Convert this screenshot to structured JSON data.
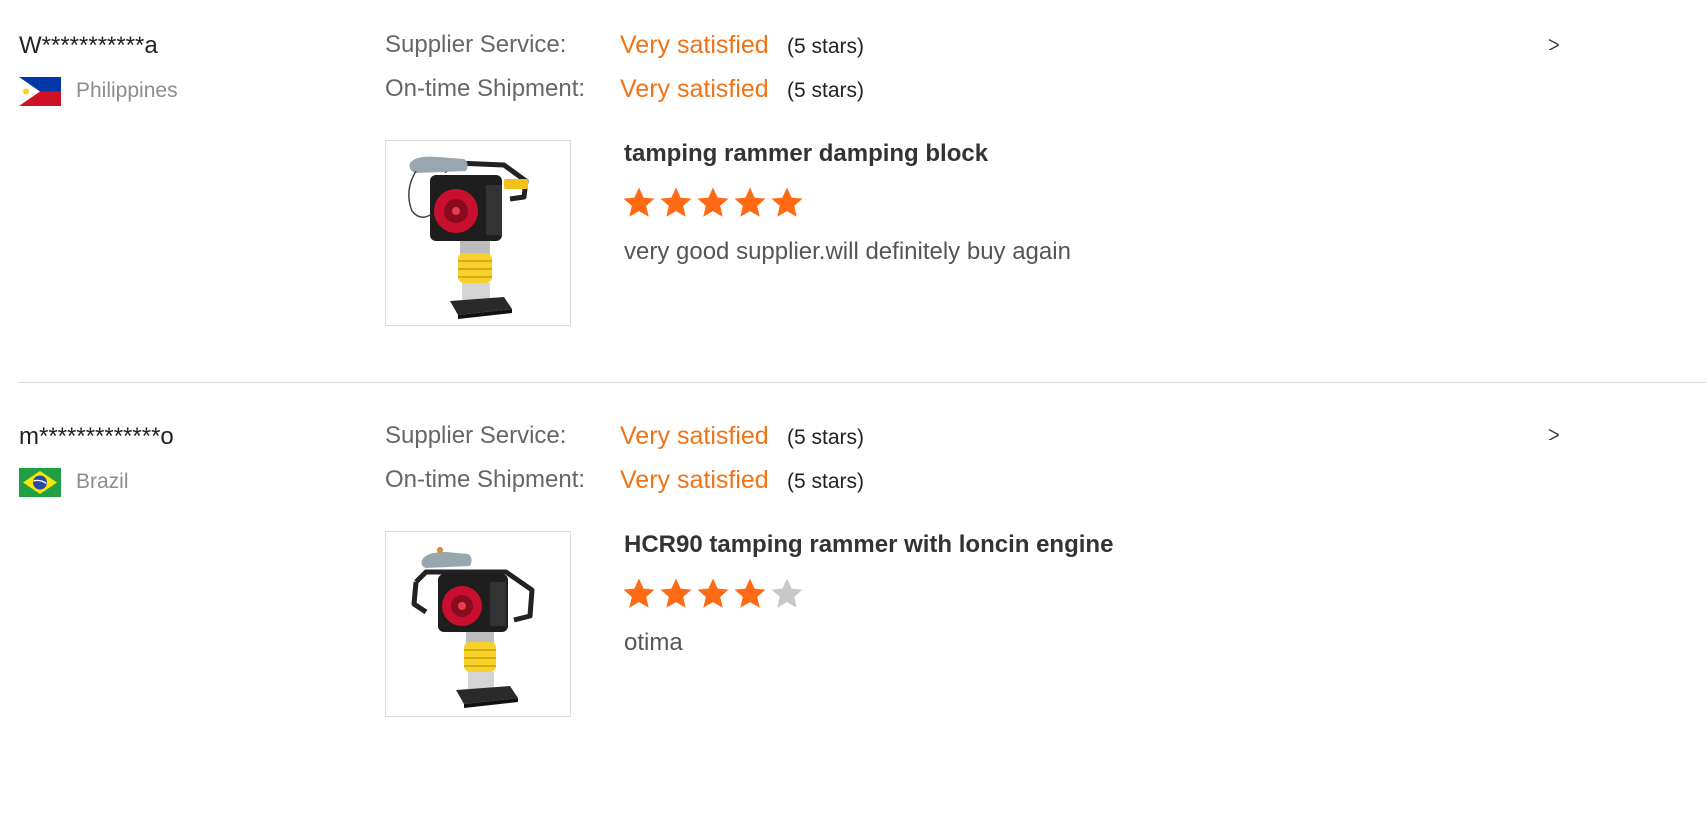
{
  "reviews": [
    {
      "reviewer": "W***********a",
      "country": "Philippines",
      "flag_icon": "philippines-flag-icon",
      "supplier_service": {
        "label": "Supplier Service:",
        "value": "Very satisfied",
        "stars_text": "(5 stars)"
      },
      "shipment": {
        "label": "On-time Shipment:",
        "value": "Very satisfied",
        "stars_text": "(5 stars)"
      },
      "product": {
        "title": "tamping rammer damping block",
        "image_icon": "tamping-rammer-image"
      },
      "rating": 5,
      "comment": "very good supplier.will definitely buy again"
    },
    {
      "reviewer": "m*************o",
      "country": "Brazil",
      "flag_icon": "brazil-flag-icon",
      "supplier_service": {
        "label": "Supplier Service:",
        "value": "Very satisfied",
        "stars_text": "(5 stars)"
      },
      "shipment": {
        "label": "On-time Shipment:",
        "value": "Very satisfied",
        "stars_text": "(5 stars)"
      },
      "product": {
        "title": "HCR90 tamping rammer with loncin engine",
        "image_icon": "tamping-rammer-image"
      },
      "rating": 4,
      "comment": "otima"
    }
  ],
  "colors": {
    "accent": "#f07316",
    "star_filled": "#ff6a14",
    "star_empty": "#c8c8c8",
    "divider": "#d9d9d9"
  }
}
